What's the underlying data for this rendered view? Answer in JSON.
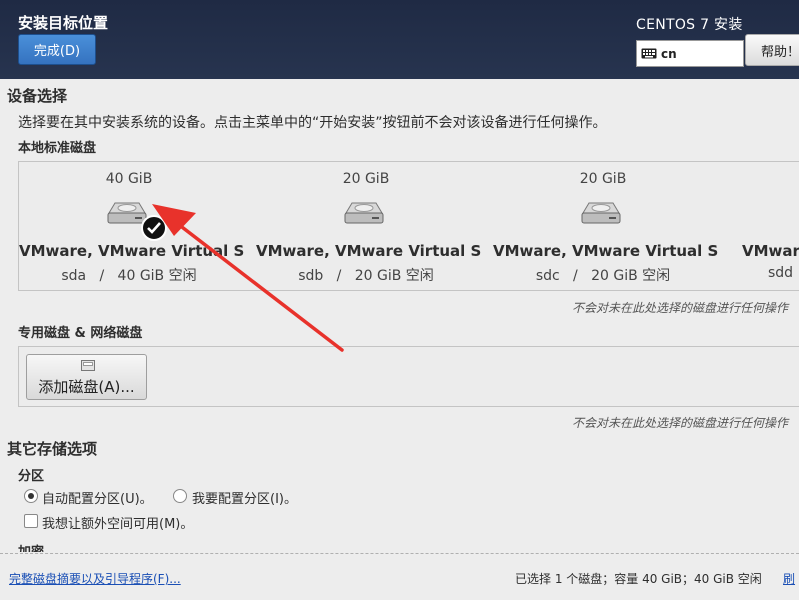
{
  "header": {
    "title": "安装目标位置",
    "done_label": "完成(D)",
    "product": "CENTOS 7 安装",
    "keyboard_layout": "cn",
    "help_label": "帮助！"
  },
  "device_selection": {
    "title": "设备选择",
    "description": "选择要在其中安装系统的设备。点击主菜单中的“开始安装”按钮前不会对该设备进行任何操作。",
    "local_disks_label": "本地标准磁盘",
    "disks": [
      {
        "size": "40 GiB",
        "model": "VMware, VMware Virtual S",
        "info": "sda   /   40 GiB 空闲",
        "selected": true
      },
      {
        "size": "20 GiB",
        "model": "VMware, VMware Virtual S",
        "info": "sdb   /   20 GiB 空闲",
        "selected": false
      },
      {
        "size": "20 GiB",
        "model": "VMware, VMware Virtual S",
        "info": "sdc   /   20 GiB 空闲",
        "selected": false
      },
      {
        "size": "",
        "model": "VMware",
        "info": "sdd",
        "selected": false
      }
    ],
    "local_note": "不会对未在此处选择的磁盘进行任何操作",
    "special_label": "专用磁盘 & 网络磁盘",
    "add_disk_label": "添加磁盘(A)...",
    "special_note": "不会对未在此处选择的磁盘进行任何操作"
  },
  "other_storage": {
    "title": "其它存储选项",
    "partition_label": "分区",
    "auto_partition": "自动配置分区(U)。",
    "manual_partition": "我要配置分区(I)。",
    "extra_space": "我想让额外空间可用(M)。",
    "encryption_label": "加密"
  },
  "footer": {
    "summary_link": "完整磁盘摘要以及引导程序(F)...",
    "status": "已选择 1 个磁盘；容量 40 GiB；40 GiB 空闲",
    "refresh_link": "刷"
  },
  "colors": {
    "header_bg": "#1f2a44",
    "accent_button": "#3573c0",
    "annotation_arrow": "#e8322b",
    "link": "#1a4fb5"
  }
}
